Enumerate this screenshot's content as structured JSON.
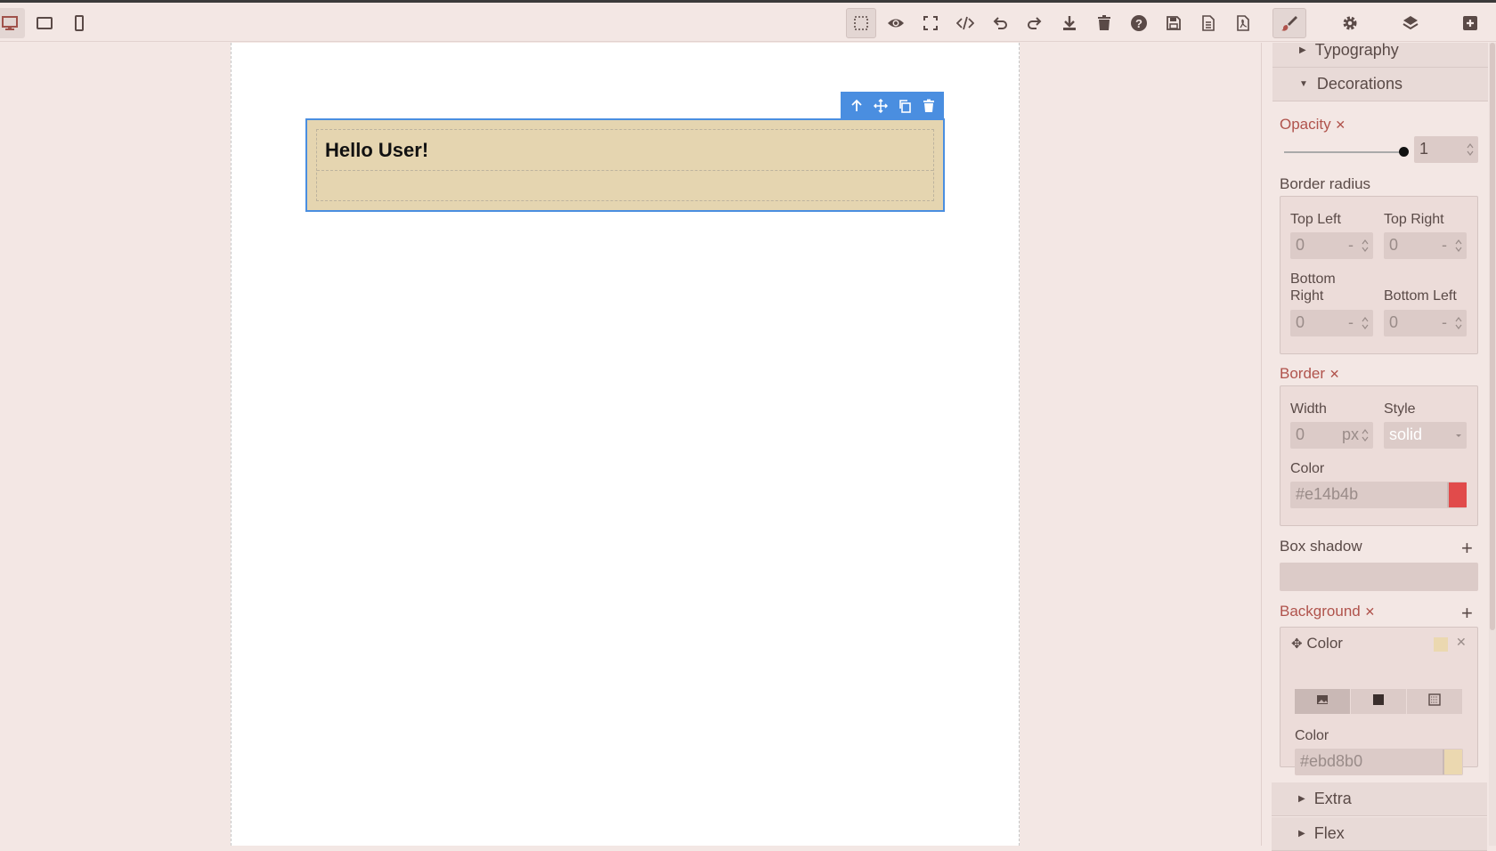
{
  "colors": {
    "accent": "#4a8ee0",
    "label_active": "#b0534c",
    "panel_bg": "#f3e7e4",
    "border_color": "#e14b4b",
    "background_color": "#ebd8b0"
  },
  "toolbar": {
    "left_icons": [
      "desktop-icon",
      "tablet-icon",
      "mobile-icon"
    ],
    "center_icons": [
      "sw-visibility-icon",
      "preview-icon",
      "fullscreen-icon",
      "code-icon",
      "undo-icon",
      "redo-icon",
      "download-icon",
      "trash-icon",
      "help-icon",
      "save-icon",
      "document-icon",
      "pdf-icon"
    ],
    "right_icons": [
      "style-manager-icon",
      "settings-icon",
      "layers-icon",
      "blocks-icon"
    ]
  },
  "canvas": {
    "text": "Hello User!",
    "badge_icons": [
      "arrow-up-icon",
      "move-icon",
      "clone-icon",
      "delete-icon"
    ]
  },
  "panel": {
    "typography": "Typography",
    "decorations": "Decorations",
    "opacity": {
      "label": "Opacity",
      "value": "1",
      "clear": "✕"
    },
    "border_radius": {
      "label": "Border radius",
      "top_left": {
        "label": "Top Left",
        "value": "0",
        "unit": "-"
      },
      "top_right": {
        "label": "Top Right",
        "value": "0",
        "unit": "-"
      },
      "bottom_right": {
        "label_1": "Bottom",
        "label_2": "Right",
        "value": "0",
        "unit": "-"
      },
      "bottom_left": {
        "label": "Bottom Left",
        "value": "0",
        "unit": "-"
      }
    },
    "border": {
      "label": "Border",
      "clear": "✕",
      "width": {
        "label": "Width",
        "value": "0",
        "unit": "px"
      },
      "style": {
        "label": "Style",
        "value": "solid"
      },
      "color": {
        "label": "Color",
        "value": "#e14b4b"
      }
    },
    "box_shadow": {
      "label": "Box shadow",
      "add": "+"
    },
    "background": {
      "label": "Background",
      "clear": "✕",
      "add": "+",
      "layer": {
        "title": "Color",
        "close": "✕"
      },
      "color": {
        "label": "Color",
        "value": "#ebd8b0"
      }
    },
    "extra": "Extra",
    "flex": "Flex"
  }
}
